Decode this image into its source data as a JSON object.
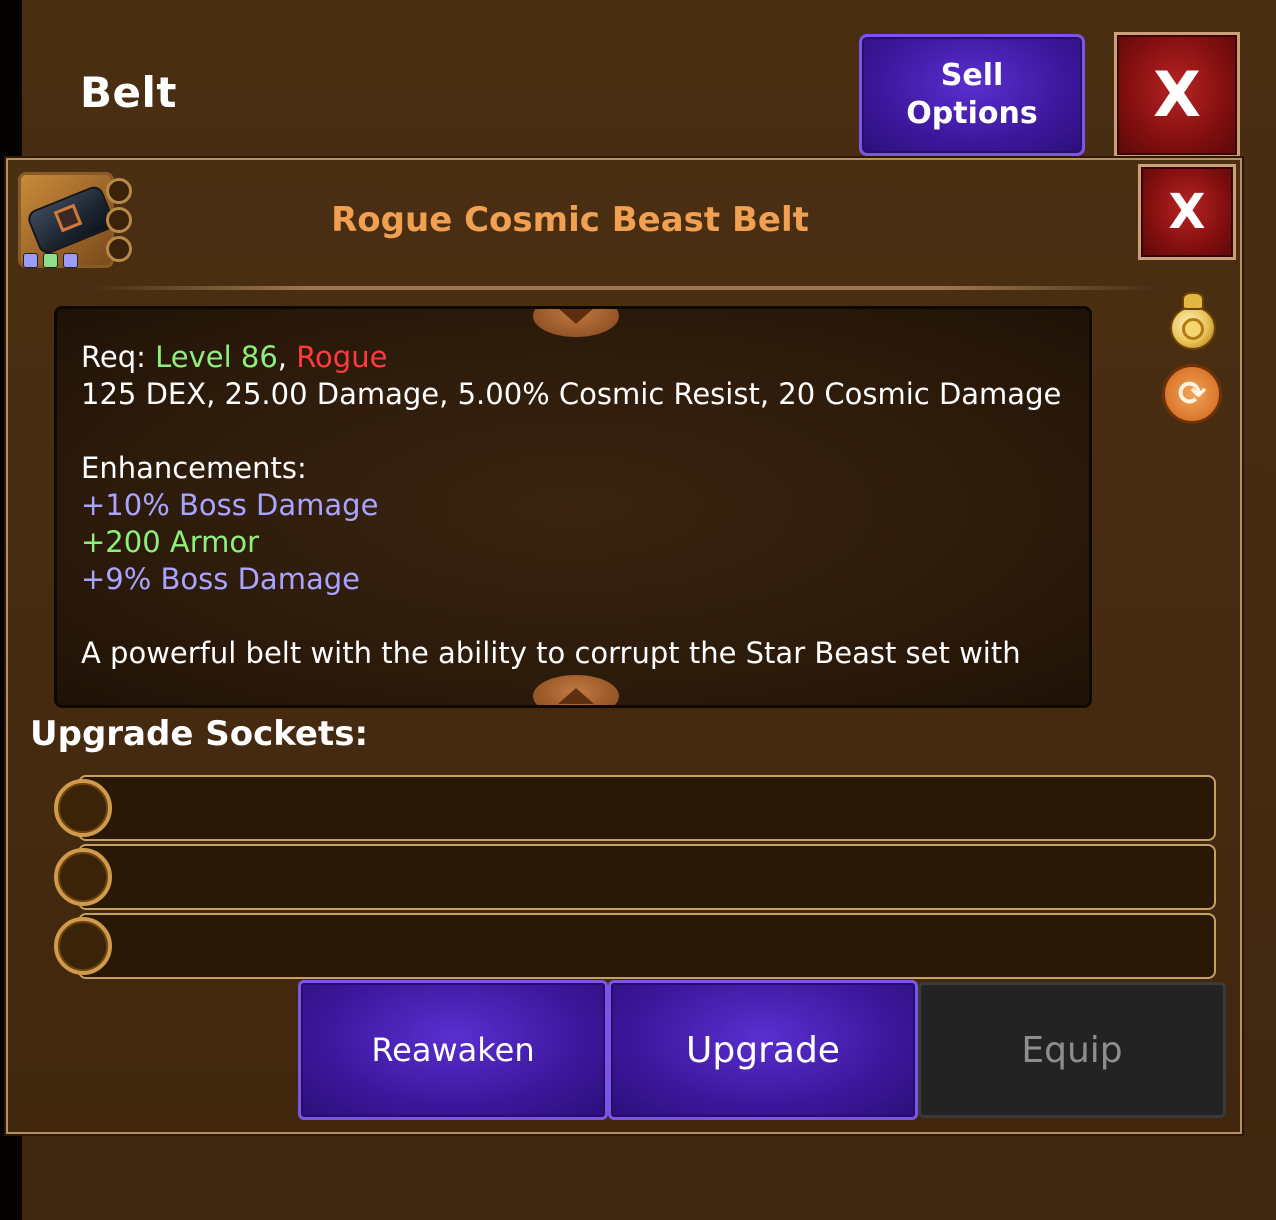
{
  "window": {
    "title": "Belt"
  },
  "header": {
    "sell_options_label": "Sell\nOptions",
    "close_label": "X"
  },
  "item": {
    "name": "Rogue Cosmic Beast Belt",
    "name_color": "#f0a050",
    "close_label": "X",
    "socket_gem_colors": [
      "#9c9cff",
      "#8ce08c",
      "#9c9cff"
    ],
    "req_prefix": "Req: ",
    "req_level": "Level 86",
    "req_sep": ", ",
    "req_class": "Rogue",
    "stats": "125 DEX, 25.00 Damage, 5.00% Cosmic Resist, 20 Cosmic Damage",
    "enhancements_header": "Enhancements:",
    "enhancements": [
      {
        "text": "+10% Boss Damage",
        "color": "violet"
      },
      {
        "text": "+200 Armor",
        "color": "green"
      },
      {
        "text": "+9% Boss Damage",
        "color": "violet"
      }
    ],
    "description": "A powerful belt with the ability to corrupt the Star Beast set with"
  },
  "side_icons": [
    "coin-bag-icon",
    "cycle-arrows-icon"
  ],
  "upgrade_sockets": {
    "label": "Upgrade Sockets:",
    "count": 3
  },
  "actions": {
    "reawaken": "Reawaken",
    "upgrade": "Upgrade",
    "equip": "Equip"
  },
  "colors": {
    "accent_purple": "#3c179c",
    "close_red": "#861010",
    "level_green": "#8cf07a",
    "class_red": "#ff3a3a",
    "enhancement_violet": "#a8a4ff"
  }
}
